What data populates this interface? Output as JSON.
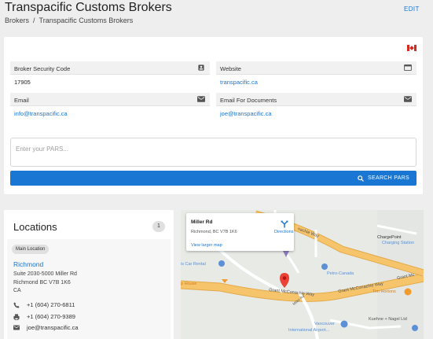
{
  "header": {
    "title": "Transpacific Customs Brokers",
    "edit_label": "EDIT",
    "breadcrumb": {
      "parent": "Brokers",
      "separator": "/",
      "current": "Transpacific Customs Brokers"
    }
  },
  "details": {
    "flag_icon": "canada-flag-icon",
    "fields": {
      "security_code": {
        "label": "Broker Security Code",
        "value": "17905",
        "icon": "id-badge-icon"
      },
      "website": {
        "label": "Website",
        "value": "transpacific.ca",
        "icon": "web-icon"
      },
      "email": {
        "label": "Email",
        "value": "info@transpacific.ca",
        "icon": "email-icon"
      },
      "email_docs": {
        "label": "Email For Documents",
        "value": "joe@transpacific.ca",
        "icon": "email-icon"
      }
    },
    "pars": {
      "placeholder": "Enter your PARS..."
    },
    "search_button": "SEARCH PARS"
  },
  "locations": {
    "title": "Locations",
    "count": "1",
    "item": {
      "chip": "Main Location",
      "name": "Richmond",
      "address": [
        "Suite 2030-5000 Miller Rd",
        "Richmond BC V7B 1K6",
        "CA"
      ],
      "phone": "+1 (604) 270-6811",
      "fax": "+1 (604) 270-9389",
      "email": "joe@transpacific.ca"
    }
  },
  "map": {
    "popup": {
      "title": "Miller Rd",
      "address": "Richmond, BC V7B 1K6",
      "directions": "Directions",
      "larger_map": "View larger map"
    },
    "labels": {
      "chargepoint": "ChargePoint",
      "charging_station": "Charging Station",
      "car_rental": "is Car Rental",
      "petro": "Petro-Canada",
      "house": "p House",
      "grant1": "Grant McConachie Way",
      "grant2": "Grant McConachie Way",
      "grant3": "Grant Mc",
      "conachie_way": "nachie Way",
      "tim": "Tim Hortons",
      "kuehne": "Kuehne + Nagel Ltd",
      "vancouver": "Vancouver",
      "airport": "International Airport...",
      "miller": "Miller Rd"
    },
    "colors": {
      "road": "#f6c56b",
      "road_edge": "#e3a94a",
      "pin": "#ea4335",
      "poi_blue": "#5b8fd6",
      "poi_orange": "#f29a2e",
      "poi_purple": "#8e7cc3"
    }
  },
  "colors": {
    "accent": "#1976d2"
  }
}
